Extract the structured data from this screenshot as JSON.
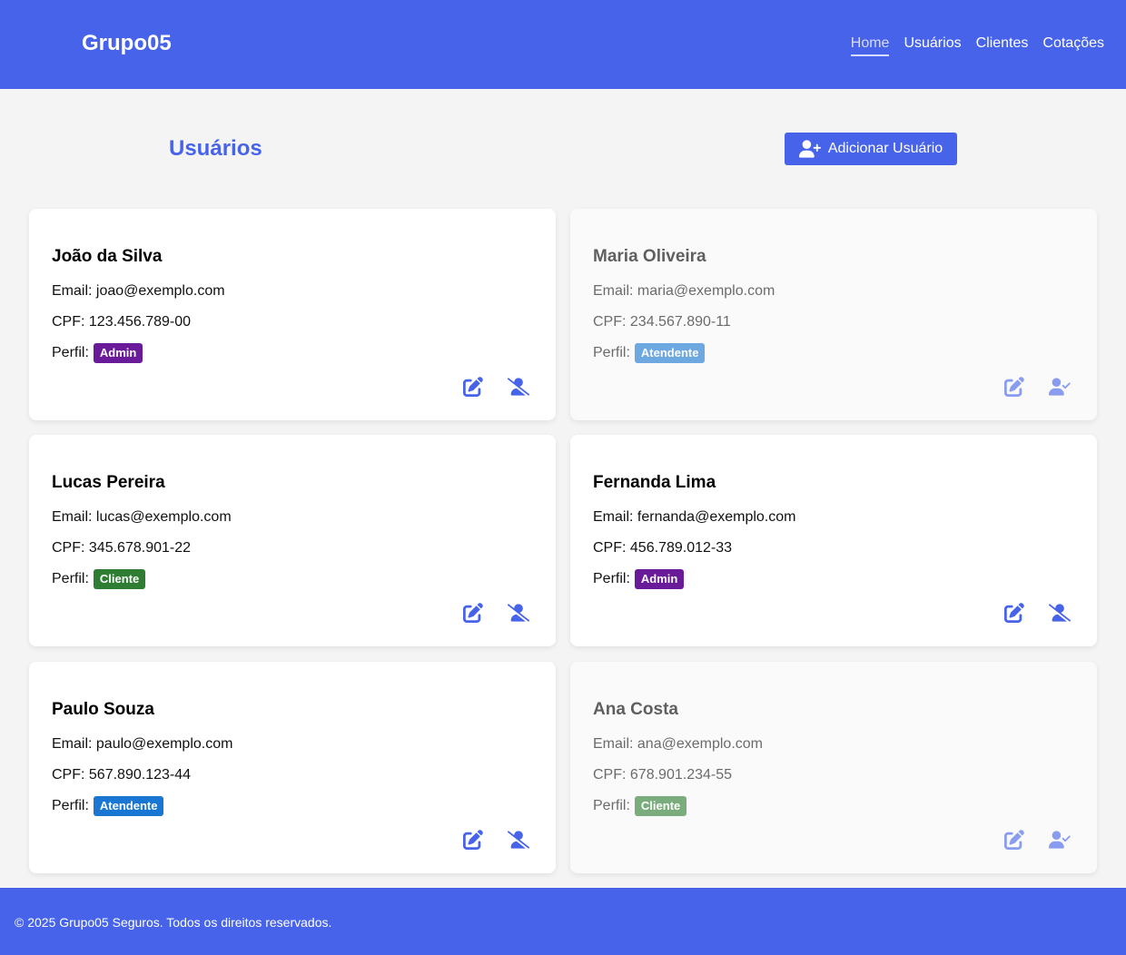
{
  "header": {
    "brand": "Grupo05",
    "nav": [
      {
        "label": "Home",
        "active": true
      },
      {
        "label": "Usuários",
        "active": false
      },
      {
        "label": "Clientes",
        "active": false
      },
      {
        "label": "Cotações",
        "active": false
      }
    ]
  },
  "page": {
    "title": "Usuários",
    "add_button_label": "Adicionar Usuário",
    "add_button_icon": "user-plus-icon"
  },
  "labels": {
    "email": "Email:",
    "cpf": "CPF:",
    "perfil": "Perfil:"
  },
  "users": [
    {
      "name": "João da Silva",
      "email": "joao@exemplo.com",
      "cpf": "123.456.789-00",
      "perfil": "Admin",
      "active": true
    },
    {
      "name": "Maria Oliveira",
      "email": "maria@exemplo.com",
      "cpf": "234.567.890-11",
      "perfil": "Atendente",
      "active": false
    },
    {
      "name": "Lucas Pereira",
      "email": "lucas@exemplo.com",
      "cpf": "345.678.901-22",
      "perfil": "Cliente",
      "active": true
    },
    {
      "name": "Fernanda Lima",
      "email": "fernanda@exemplo.com",
      "cpf": "456.789.012-33",
      "perfil": "Admin",
      "active": true
    },
    {
      "name": "Paulo Souza",
      "email": "paulo@exemplo.com",
      "cpf": "567.890.123-44",
      "perfil": "Atendente",
      "active": true
    },
    {
      "name": "Ana Costa",
      "email": "ana@exemplo.com",
      "cpf": "678.901.234-55",
      "perfil": "Cliente",
      "active": false
    }
  ],
  "icons": {
    "edit": "edit-icon",
    "deactivate": "user-slash-icon",
    "activate": "user-check-icon"
  },
  "colors": {
    "primary": "#4663ea",
    "admin": "#6a1b9a",
    "atendente": "#1976d2",
    "cliente": "#2e7d32"
  },
  "footer": {
    "text": "© 2025 Grupo05 Seguros. Todos os direitos reservados."
  }
}
